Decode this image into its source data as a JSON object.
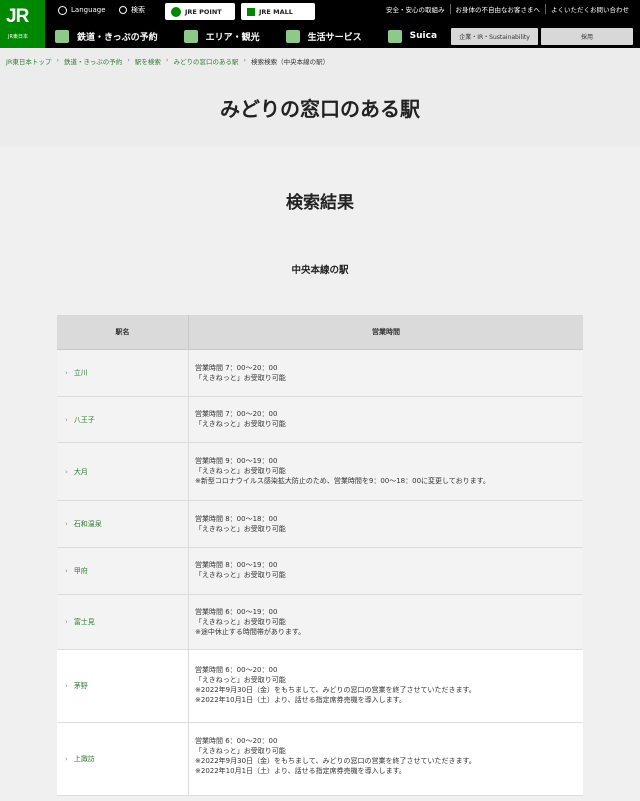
{
  "logo": {
    "mark": "JR",
    "sub": "JR東日本"
  },
  "header": {
    "language": "Language",
    "search": "検索",
    "jre_point": "JRE POINT",
    "jre_mall": "JRE MALL",
    "links": [
      "安全・安心の取組み",
      "お身体の不自由なお客さまへ",
      "よくいただくお問い合わせ"
    ],
    "nav": [
      "鉄道・きっぷの予約",
      "エリア・観光",
      "生活サービス",
      "Suica"
    ],
    "corp_button": "企業・IR・Sustainability",
    "recruit_button": "採用"
  },
  "breadcrumb": [
    "JR東日本トップ",
    "鉄道・きっぷの予約",
    "駅を検索",
    "みどりの窓口のある駅",
    "検索検索（中央本線の駅）"
  ],
  "page_title": "みどりの窓口のある駅",
  "results_title": "検索結果",
  "line_title": "中央本線の駅",
  "table": {
    "col_name": "駅名",
    "col_hours": "営業時間",
    "rows": [
      {
        "name": "立川",
        "lines": [
          "営業時間 7：00～20：00",
          "「えきねっと」お受取り可能"
        ]
      },
      {
        "name": "八王子",
        "lines": [
          "営業時間 7：00～20：00",
          "「えきねっと」お受取り可能"
        ]
      },
      {
        "name": "大月",
        "lines": [
          "営業時間 9：00～19：00",
          "「えきねっと」お受取り可能",
          "※新型コロナウイルス感染拡大防止のため、営業時間を9：00～18：00に変更しております。"
        ]
      },
      {
        "name": "石和温泉",
        "lines": [
          "営業時間 8：00～18：00",
          "「えきねっと」お受取り可能"
        ]
      },
      {
        "name": "甲府",
        "lines": [
          "営業時間 8：00～19：00",
          "「えきねっと」お受取り可能"
        ]
      },
      {
        "name": "富士見",
        "lines": [
          "営業時間 6：00～19：00",
          "「えきねっと」お受取り可能",
          "※途中休止する時間帯があります。"
        ]
      },
      {
        "name": "茅野",
        "lines": [
          "営業時間 6：00～20：00",
          "「えきねっと」お受取り可能",
          "※2022年9月30日（金）をもちまして、みどりの窓口の営業を終了させていただきます。",
          "※2022年10月1日（土）より、話せる指定席券売機を導入します。"
        ]
      },
      {
        "name": "上諏訪",
        "lines": [
          "営業時間 6：00～20：00",
          "「えきねっと」お受取り可能",
          "※2022年9月30日（金）をもちまして、みどりの窓口の営業を終了させていただきます。",
          "※2022年10月1日（土）より、話せる指定席券売機を導入します。"
        ]
      }
    ]
  }
}
